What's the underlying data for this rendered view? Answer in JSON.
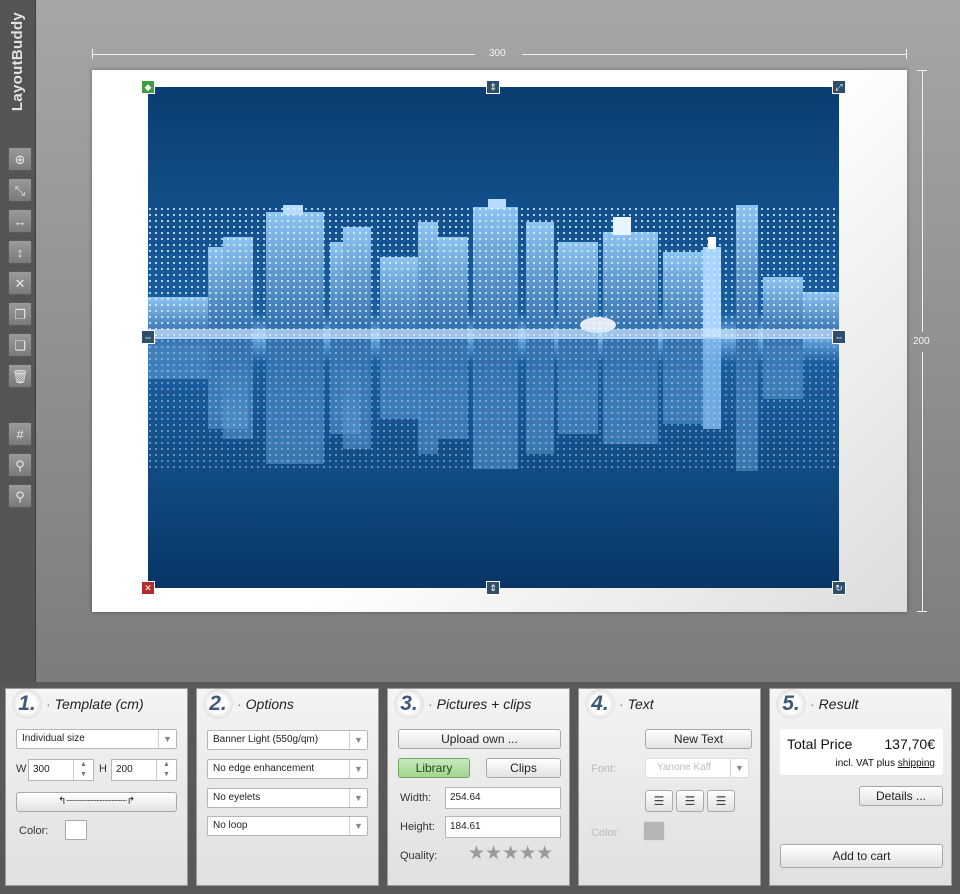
{
  "app": {
    "brand": "LayoutBuddy"
  },
  "sidebar": {
    "tools": [
      {
        "name": "add-icon",
        "glyph": "⊕"
      },
      {
        "name": "fit-icon",
        "glyph": "⤡"
      },
      {
        "name": "fit-width-icon",
        "glyph": "↔"
      },
      {
        "name": "fit-height-icon",
        "glyph": "↕"
      },
      {
        "name": "stretch-icon",
        "glyph": "✕"
      },
      {
        "name": "bring-front-icon",
        "glyph": "❐"
      },
      {
        "name": "send-back-icon",
        "glyph": "❏"
      },
      {
        "name": "trash-icon",
        "glyph": "🗑"
      },
      {
        "name": "grid-icon",
        "glyph": "#"
      },
      {
        "name": "zoom-in-icon",
        "glyph": "⚲"
      },
      {
        "name": "zoom-out-icon",
        "glyph": "⚲"
      }
    ]
  },
  "ruler": {
    "width_label": "300",
    "height_label": "200"
  },
  "panels": {
    "template": {
      "num": "1.",
      "title": "Template (cm)",
      "size_select": "Individual size",
      "w_label": "W",
      "w_value": "300",
      "h_label": "H",
      "h_value": "200",
      "color_label": "Color:"
    },
    "options": {
      "num": "2.",
      "title": "Options",
      "material": "Banner Light (550g/qm)",
      "edge": "No edge enhancement",
      "eyelets": "No eyelets",
      "loop": "No loop"
    },
    "pictures": {
      "num": "3.",
      "title": "Pictures + clips",
      "upload": "Upload own ...",
      "library": "Library",
      "clips": "Clips",
      "width_label": "Width:",
      "width_value": "254.64",
      "height_label": "Height:",
      "height_value": "184.61",
      "quality_label": "Quality:",
      "stars": "★★★★★"
    },
    "text": {
      "num": "4.",
      "title": "Text",
      "new_text": "New Text",
      "font_label": "Font:",
      "font_value": "Yanone Kaff",
      "color_label": "Color:"
    },
    "result": {
      "num": "5.",
      "title": "Result",
      "total_label": "Total Price",
      "total_value": "137,70€",
      "vat_text": "incl. VAT plus",
      "shipping": "shipping",
      "details": "Details ...",
      "add_to_cart": "Add to cart"
    }
  },
  "colors": {
    "accent": "#3d5a78",
    "photo_blue": "#0f4a80",
    "green_button": "#9ed68c"
  }
}
